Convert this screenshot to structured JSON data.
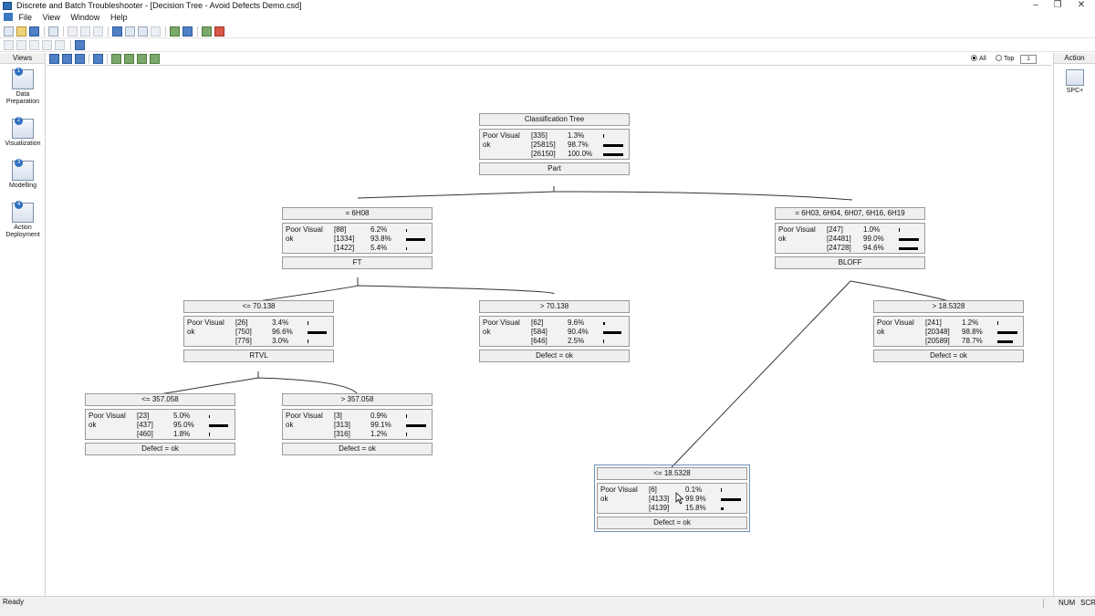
{
  "window": {
    "title": "Discrete and Batch Troubleshooter - [Decision Tree - Avoid Defects Demo.csd]",
    "minimize": "–",
    "restore": "❐",
    "close": "✕"
  },
  "menu": [
    "File",
    "View",
    "Window",
    "Help"
  ],
  "views": {
    "header": "Views",
    "items": [
      {
        "num": "1",
        "label": "Data Preparation"
      },
      {
        "num": "2",
        "label": "Visualization"
      },
      {
        "num": "3",
        "label": "Modelling"
      },
      {
        "num": "4",
        "label": "Action Deployment"
      }
    ]
  },
  "action": {
    "header": "Action",
    "items": [
      {
        "label": "SPC+"
      }
    ]
  },
  "display": {
    "all_label": "All",
    "top_label": "Top",
    "top_value": "1",
    "selected": "all"
  },
  "status": {
    "text": "Ready",
    "num": "NUM",
    "scrl": "SCRL"
  },
  "tree": {
    "nodes": [
      {
        "id": "root",
        "header": "Classification Tree",
        "footer": "Part",
        "rows": [
          {
            "label": "Poor Visual",
            "count": "[335]",
            "pct": "1.3%",
            "bar": 0.013
          },
          {
            "label": "ok",
            "count": "[25815]",
            "pct": "98.7%",
            "bar": 0.987
          },
          {
            "label": "",
            "count": "[26150]",
            "pct": "100.0%",
            "bar": 1.0
          }
        ]
      },
      {
        "id": "n1",
        "header": "= 6H08",
        "footer": "FT",
        "rows": [
          {
            "label": "Poor Visual",
            "count": "[88]",
            "pct": "6.2%",
            "bar": 0.062
          },
          {
            "label": "ok",
            "count": "[1334]",
            "pct": "93.8%",
            "bar": 0.938
          },
          {
            "label": "",
            "count": "[1422]",
            "pct": "5.4%",
            "bar": 0.054
          }
        ]
      },
      {
        "id": "n2",
        "header": "= 6H03, 6H04, 6H07, 6H16, 6H19",
        "footer": "BLOFF",
        "rows": [
          {
            "label": "Poor Visual",
            "count": "[247]",
            "pct": "1.0%",
            "bar": 0.01
          },
          {
            "label": "ok",
            "count": "[24481]",
            "pct": "99.0%",
            "bar": 0.99
          },
          {
            "label": "",
            "count": "[24728]",
            "pct": "94.6%",
            "bar": 0.946
          }
        ]
      },
      {
        "id": "n3",
        "header": "<= 70.138",
        "footer": "RTVL",
        "rows": [
          {
            "label": "Poor Visual",
            "count": "[26]",
            "pct": "3.4%",
            "bar": 0.034
          },
          {
            "label": "ok",
            "count": "[750]",
            "pct": "96.6%",
            "bar": 0.966
          },
          {
            "label": "",
            "count": "[776]",
            "pct": "3.0%",
            "bar": 0.03
          }
        ]
      },
      {
        "id": "n4",
        "header": "> 70.138",
        "footer": "Defect = ok",
        "rows": [
          {
            "label": "Poor Visual",
            "count": "[62]",
            "pct": "9.6%",
            "bar": 0.096
          },
          {
            "label": "ok",
            "count": "[584]",
            "pct": "90.4%",
            "bar": 0.904
          },
          {
            "label": "",
            "count": "[646]",
            "pct": "2.5%",
            "bar": 0.025
          }
        ]
      },
      {
        "id": "n5",
        "header": "> 18.5328",
        "footer": "Defect = ok",
        "rows": [
          {
            "label": "Poor Visual",
            "count": "[241]",
            "pct": "1.2%",
            "bar": 0.012
          },
          {
            "label": "ok",
            "count": "[20348]",
            "pct": "98.8%",
            "bar": 0.988
          },
          {
            "label": "",
            "count": "[20589]",
            "pct": "78.7%",
            "bar": 0.787
          }
        ]
      },
      {
        "id": "n6",
        "header": "<= 357.058",
        "footer": "Defect = ok",
        "rows": [
          {
            "label": "Poor Visual",
            "count": "[23]",
            "pct": "5.0%",
            "bar": 0.05
          },
          {
            "label": "ok",
            "count": "[437]",
            "pct": "95.0%",
            "bar": 0.95
          },
          {
            "label": "",
            "count": "[460]",
            "pct": "1.8%",
            "bar": 0.018
          }
        ]
      },
      {
        "id": "n7",
        "header": "> 357.058",
        "footer": "Defect = ok",
        "rows": [
          {
            "label": "Poor Visual",
            "count": "[3]",
            "pct": "0.9%",
            "bar": 0.009
          },
          {
            "label": "ok",
            "count": "[313]",
            "pct": "99.1%",
            "bar": 0.991
          },
          {
            "label": "",
            "count": "[316]",
            "pct": "1.2%",
            "bar": 0.012
          }
        ]
      },
      {
        "id": "n8",
        "header": "<= 18.5328",
        "footer": "Defect = ok",
        "rows": [
          {
            "label": "Poor Visual",
            "count": "[6]",
            "pct": "0.1%",
            "bar": 0.001
          },
          {
            "label": "ok",
            "count": "[4133]",
            "pct": "99.9%",
            "bar": 0.999
          },
          {
            "label": "",
            "count": "[4139]",
            "pct": "15.8%",
            "bar": 0.158
          }
        ]
      }
    ],
    "selected": "n8"
  }
}
